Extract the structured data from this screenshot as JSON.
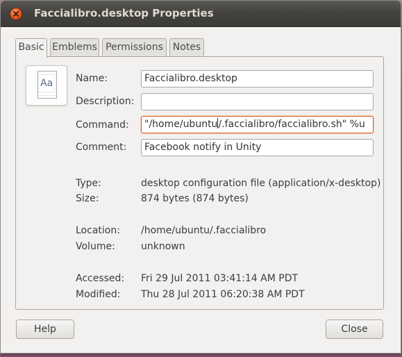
{
  "window": {
    "title": "Faccialibro.desktop Properties"
  },
  "tabs": [
    {
      "label": "Basic",
      "active": true
    },
    {
      "label": "Emblems",
      "active": false
    },
    {
      "label": "Permissions",
      "active": false
    },
    {
      "label": "Notes",
      "active": false
    }
  ],
  "file_icon": {
    "text": "Aa",
    "icon": "text-document-icon"
  },
  "fields": {
    "name": {
      "label": "Name:",
      "value": "Faccialibro.desktop"
    },
    "description": {
      "label": "Description:",
      "value": ""
    },
    "command": {
      "label": "Command:",
      "value_before_caret": "\"/home/ubuntu",
      "value_after_caret": "/.faccialibro/faccialibro.sh\" %u"
    },
    "comment": {
      "label": "Comment:",
      "value": "Facebook notify in Unity"
    }
  },
  "info": {
    "type": {
      "label": "Type:",
      "value": "desktop configuration file (application/x-desktop)"
    },
    "size": {
      "label": "Size:",
      "value": "874 bytes (874 bytes)"
    },
    "location": {
      "label": "Location:",
      "value": "/home/ubuntu/.faccialibro"
    },
    "volume": {
      "label": "Volume:",
      "value": "unknown"
    },
    "accessed": {
      "label": "Accessed:",
      "value": "Fri 29 Jul 2011 03:41:14 AM PDT"
    },
    "modified": {
      "label": "Modified:",
      "value": "Thu 28 Jul 2011 06:20:38 AM PDT"
    }
  },
  "buttons": {
    "help": "Help",
    "close": "Close"
  },
  "colors": {
    "titlebar": "#3c3b37",
    "accent": "#e2601c",
    "window_bg": "#f2f1f0"
  }
}
